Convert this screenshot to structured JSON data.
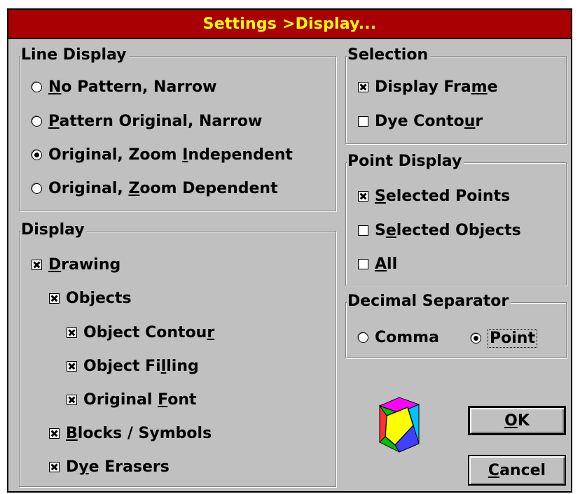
{
  "title": "Settings >Display...",
  "line_display": {
    "legend": "Line Display",
    "options": [
      {
        "pre": "",
        "key": "N",
        "post": "o Pattern, Narrow",
        "selected": false
      },
      {
        "pre": "",
        "key": "P",
        "post": "attern Original, Narrow",
        "selected": false
      },
      {
        "pre": "Original, Zoom ",
        "key": "I",
        "post": "ndependent",
        "selected": true
      },
      {
        "pre": "Original, ",
        "key": "Z",
        "post": "oom Dependent",
        "selected": false
      }
    ]
  },
  "display": {
    "legend": "Display",
    "items": [
      {
        "pre": "",
        "key": "D",
        "post": "rawing",
        "checked": true
      },
      {
        "pre": "Objects",
        "key": "",
        "post": "",
        "checked": true
      },
      {
        "pre": "Object Contou",
        "key": "r",
        "post": "",
        "checked": true
      },
      {
        "pre": "Object Fi",
        "key": "l",
        "post": "ling",
        "checked": true
      },
      {
        "pre": "Original ",
        "key": "F",
        "post": "ont",
        "checked": true
      },
      {
        "pre": "",
        "key": "B",
        "post": "locks / Symbols",
        "checked": true
      },
      {
        "pre": "D",
        "key": "y",
        "post": "e Erasers",
        "checked": true
      }
    ]
  },
  "selection": {
    "legend": "Selection",
    "items": [
      {
        "pre": "Display Fra",
        "key": "m",
        "post": "e",
        "checked": true
      },
      {
        "pre": "Dye Conto",
        "key": "u",
        "post": "r",
        "checked": false
      }
    ]
  },
  "point_display": {
    "legend": "Point Display",
    "items": [
      {
        "pre": "",
        "key": "S",
        "post": "elected Points",
        "checked": true
      },
      {
        "pre": "S",
        "key": "e",
        "post": "lected Objects",
        "checked": false
      },
      {
        "pre": "",
        "key": "A",
        "post": "ll",
        "checked": false
      }
    ]
  },
  "decimal_separator": {
    "legend": "Decimal Separator",
    "options": [
      {
        "label": "Comma",
        "selected": false
      },
      {
        "label": "Point",
        "selected": true
      }
    ]
  },
  "buttons": {
    "ok": {
      "key": "O",
      "post": "K"
    },
    "cancel": {
      "key": "C",
      "post": "ancel"
    }
  },
  "colors": {
    "title_bg": "#a80000",
    "title_fg": "#ffff00",
    "dialog_bg": "#c0c0c0"
  },
  "icons": {
    "app_logo": "colorful-cube-icon"
  }
}
